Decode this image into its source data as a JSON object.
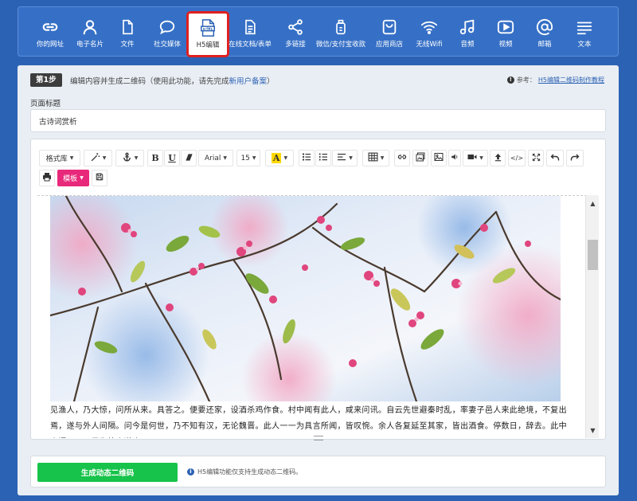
{
  "topbar": {
    "items": [
      {
        "label": "你的网址",
        "icon": "link-icon"
      },
      {
        "label": "电子名片",
        "icon": "person-icon"
      },
      {
        "label": "文件",
        "icon": "file-icon"
      },
      {
        "label": "社交媒体",
        "icon": "chat-bubble-icon"
      },
      {
        "label": "H5编辑",
        "icon": "html-file-icon",
        "active": true
      },
      {
        "label": "在线文档/表单",
        "icon": "document-icon"
      },
      {
        "label": "多链接",
        "icon": "share-icon"
      },
      {
        "label": "微信/支付宝收款",
        "icon": "wallet-icon"
      },
      {
        "label": "应用商店",
        "icon": "shopping-bag-icon"
      },
      {
        "label": "无线Wifi",
        "icon": "wifi-icon"
      },
      {
        "label": "音频",
        "icon": "music-note-icon"
      },
      {
        "label": "视频",
        "icon": "play-icon"
      },
      {
        "label": "邮箱",
        "icon": "at-sign-icon"
      },
      {
        "label": "文本",
        "icon": "text-lines-icon"
      }
    ]
  },
  "step": {
    "badge": "第1步",
    "desc_before": "编辑内容并生成二维码（使用此功能，请先完成",
    "desc_link": "新用户备案",
    "desc_after": "）",
    "ref_prefix": "参考：",
    "ref_link": "H5编辑二维码制作教程"
  },
  "form": {
    "title_label": "页面标题",
    "title_value": "古诗词赏析"
  },
  "toolbar": {
    "format_label": "格式库",
    "font_family": "Arial",
    "font_size": "15",
    "template_label": "模板"
  },
  "editor": {
    "body_text": "见渔人，乃大惊，问所从来。具答之。便要还家，设酒杀鸡作食。村中闻有此人，咸来问讯。自云先世避秦时乱，率妻子邑人来此绝境，不复出焉，遂与外人间隔。问今是何世，乃不知有汉，无论魏晋。此人一一为具言所闻，皆叹惋。余人各复延至其家，皆出酒食。停数日，辞去。此中人语云：不足为外人道也。"
  },
  "footer": {
    "generate_label": "生成动态二维码",
    "note": "H5编辑功能仅支持生成动态二维码。"
  },
  "colors": {
    "background": "#2c62b4",
    "active_border": "#e02020",
    "template_button": "#e8287a",
    "generate_button": "#17c34a"
  }
}
